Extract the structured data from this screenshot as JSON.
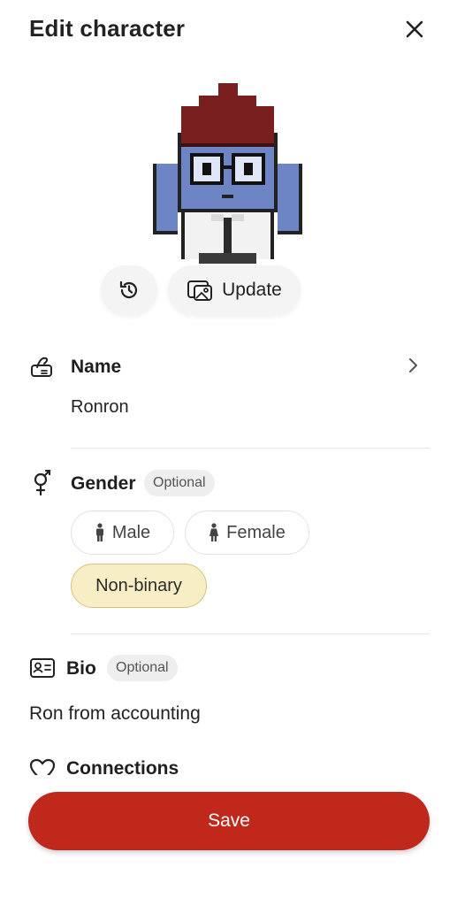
{
  "header": {
    "title": "Edit character"
  },
  "avatar": {
    "update_label": "Update"
  },
  "name_field": {
    "label": "Name",
    "value": "Ronron"
  },
  "gender_field": {
    "label": "Gender",
    "badge": "Optional",
    "options": [
      "Male",
      "Female",
      "Non-binary"
    ],
    "selected": "Non-binary"
  },
  "bio_field": {
    "label": "Bio",
    "badge": "Optional",
    "value": "Ron from accounting"
  },
  "connections_field": {
    "label": "Connections"
  },
  "footer": {
    "save_label": "Save"
  },
  "colors": {
    "accent": "#c0281c",
    "selected_bg": "#f8eec6"
  },
  "icons": [
    "close-icon",
    "history-icon",
    "image-update-icon",
    "signature-icon",
    "chevron-right-icon",
    "gender-icon",
    "male-icon",
    "female-icon",
    "id-card-icon",
    "heart-icon"
  ]
}
